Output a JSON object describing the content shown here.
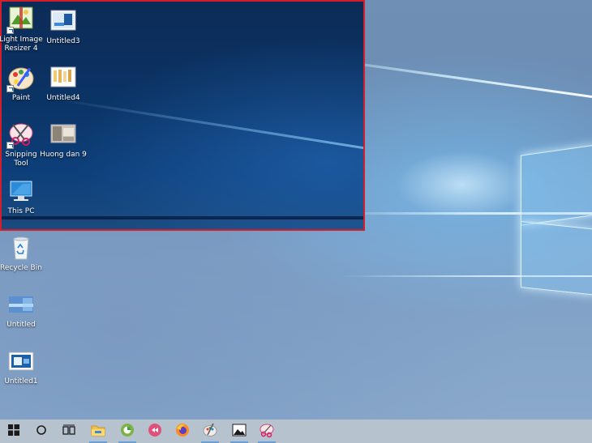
{
  "desktop_icons": [
    {
      "label": "Light Image Resizer 4",
      "icon": "light-image-resizer-icon"
    },
    {
      "label": "Untitled3",
      "icon": "image-thumbnail-icon"
    },
    {
      "label": "Paint",
      "icon": "paint-palette-icon"
    },
    {
      "label": "Untitled4",
      "icon": "image-thumbnail-icon"
    },
    {
      "label": "Snipping Tool",
      "icon": "scissors-icon"
    },
    {
      "label": "Huong dan 9",
      "icon": "image-thumbnail-icon"
    },
    {
      "label": "This PC",
      "icon": "computer-monitor-icon"
    },
    {
      "label": "Recycle Bin",
      "icon": "recycle-bin-icon"
    },
    {
      "label": "Untitled",
      "icon": "image-thumbnail-icon"
    },
    {
      "label": "Untitled1",
      "icon": "image-thumbnail-icon"
    }
  ],
  "selection_color": "#d31f2c",
  "taskbar": {
    "items": [
      {
        "icon": "windows-start-icon"
      },
      {
        "icon": "cortana-search-icon"
      },
      {
        "icon": "task-view-icon"
      },
      {
        "icon": "file-explorer-icon",
        "active": true
      },
      {
        "icon": "green-app-icon",
        "active": true
      },
      {
        "icon": "pink-app-icon"
      },
      {
        "icon": "firefox-icon"
      },
      {
        "icon": "paint-palette-icon",
        "active": true
      },
      {
        "icon": "photos-icon",
        "active": true
      },
      {
        "icon": "snipping-tool-icon",
        "active": true
      }
    ]
  }
}
